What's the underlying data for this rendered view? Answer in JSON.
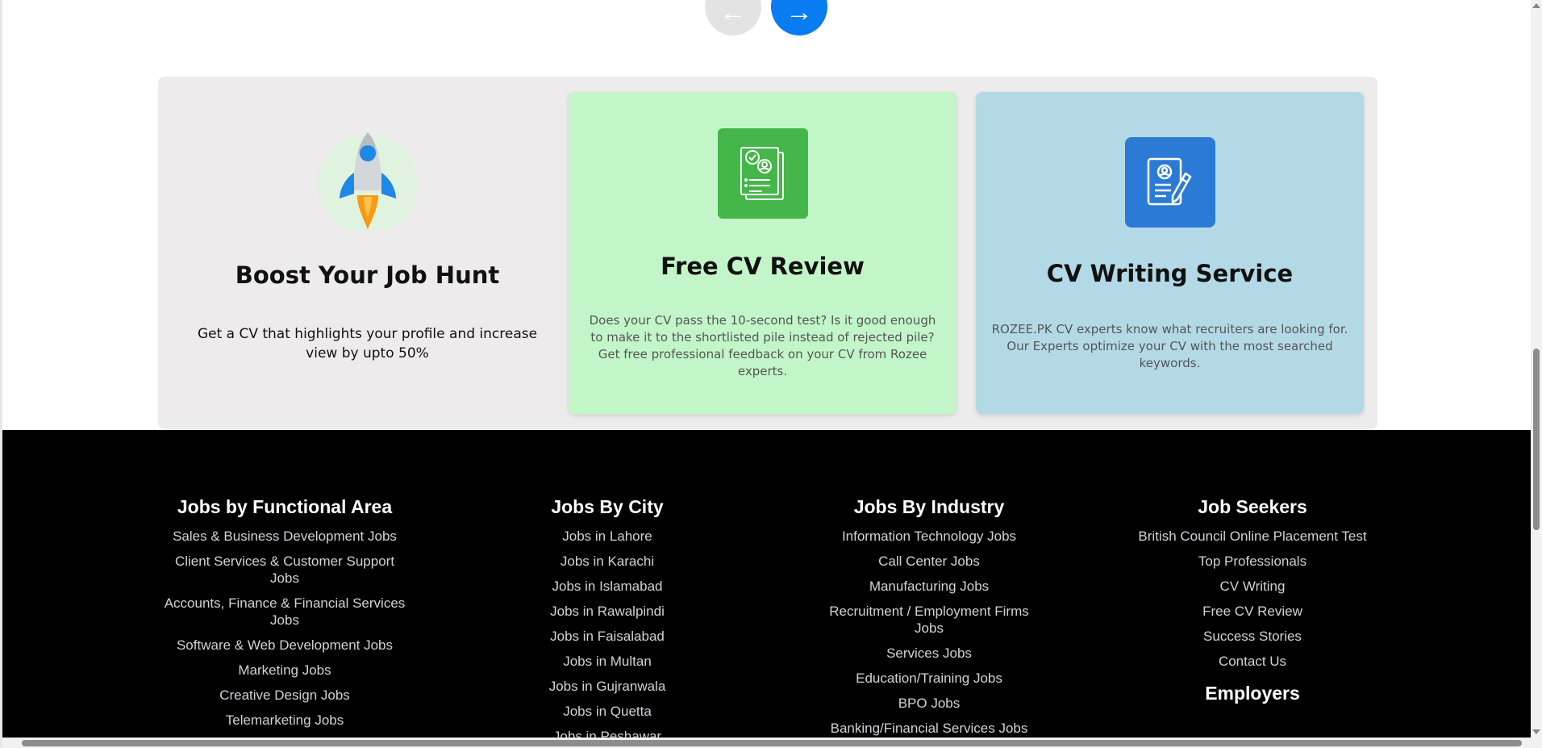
{
  "carousel": {
    "prev_icon": "←",
    "next_icon": "→",
    "colors": {
      "prev_bg": "#e3e3e3",
      "next_bg": "#0a7cf2"
    }
  },
  "promo": {
    "cards": [
      {
        "title": "Boost Your Job Hunt",
        "description": "Get a CV that highlights your profile and increase view by upto 50%",
        "icon": "rocket-icon"
      },
      {
        "title": "Free CV Review",
        "description": "Does your CV pass the 10-second test? Is it good enough to make it to the shortlisted pile instead of rejected pile? Get free professional feedback on your CV from Rozee experts.",
        "icon": "cv-review-icon",
        "color": "#c2f6c8"
      },
      {
        "title": "CV Writing Service",
        "description": "ROZEE.PK CV experts know what recruiters are looking for. Our Experts optimize your CV with the most searched keywords.",
        "icon": "cv-writing-icon",
        "color": "#b3d9e7"
      }
    ]
  },
  "footer": {
    "functional_area": {
      "title": "Jobs by Functional Area",
      "links": [
        "Sales & Business Development Jobs",
        "Client Services & Customer Support Jobs",
        "Accounts, Finance & Financial Services Jobs",
        "Software & Web Development Jobs",
        "Marketing Jobs",
        "Creative Design Jobs",
        "Telemarketing Jobs"
      ]
    },
    "city": {
      "title": "Jobs By City",
      "links": [
        "Jobs in Lahore",
        "Jobs in Karachi",
        "Jobs in Islamabad",
        "Jobs in Rawalpindi",
        "Jobs in Faisalabad",
        "Jobs in Multan",
        "Jobs in Gujranwala",
        "Jobs in Quetta",
        "Jobs in Peshawar"
      ]
    },
    "industry": {
      "title": "Jobs By Industry",
      "links": [
        "Information Technology Jobs",
        "Call Center Jobs",
        "Manufacturing Jobs",
        "Recruitment / Employment Firms Jobs",
        "Services Jobs",
        "Education/Training Jobs",
        "BPO Jobs",
        "Banking/Financial Services Jobs"
      ]
    },
    "job_seekers": {
      "title": "Job Seekers",
      "links": [
        "British Council Online Placement Test",
        "Top Professionals",
        "CV Writing",
        "Free CV Review",
        "Success Stories",
        "Contact Us"
      ]
    },
    "employers": {
      "title": "Employers"
    }
  }
}
